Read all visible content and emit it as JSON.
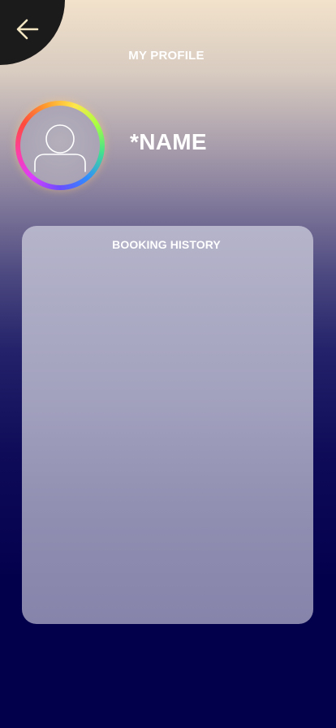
{
  "header": {
    "back_icon": "arrow-left-icon",
    "title": "MY PROFILE"
  },
  "profile": {
    "avatar_icon": "user-icon",
    "name": "*NAME"
  },
  "booking_history": {
    "title": "BOOKING HISTORY",
    "items": []
  },
  "colors": {
    "back_button_bg": "#1c1b1b",
    "arrow": "#f3e6c2",
    "text": "#ffffff",
    "bottom_bg": "#02004a",
    "card_bg": "#a4a3bf"
  }
}
